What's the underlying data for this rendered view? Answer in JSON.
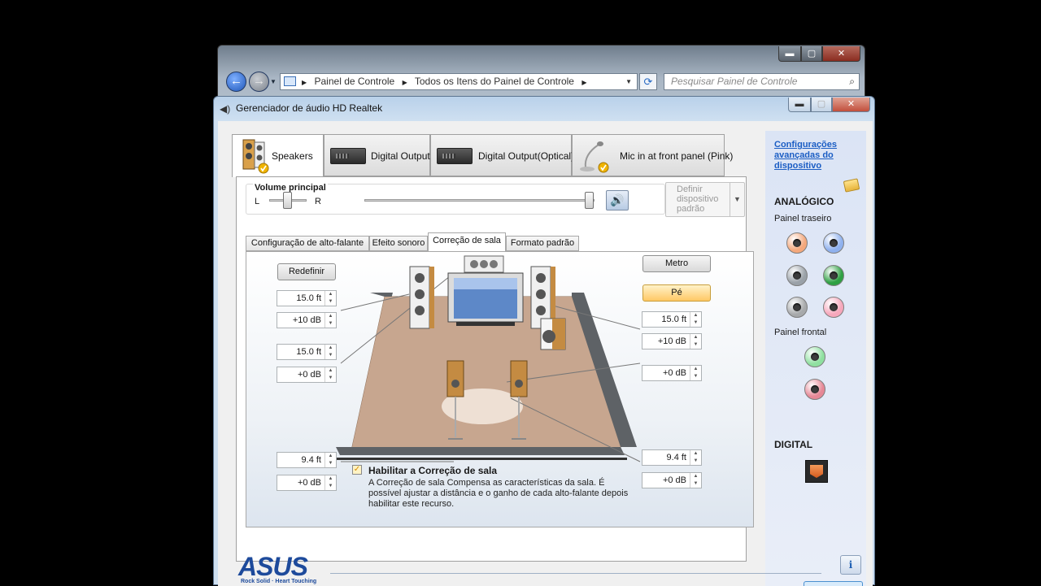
{
  "explorer": {
    "breadcrumb": [
      "Painel de Controle",
      "Todos os Itens do Painel de Controle"
    ],
    "search_placeholder": "Pesquisar Painel de Controle",
    "buttons": {
      "minimize": "▬",
      "maximize": "▢",
      "close": "✕"
    }
  },
  "window": {
    "title": "Gerenciador de áudio HD Realtek",
    "buttons": {
      "minimize": "▬",
      "maximize": "▢",
      "close": "✕"
    }
  },
  "device_tabs": [
    {
      "label": "Speakers",
      "active": true
    },
    {
      "label": "Digital Output",
      "active": false
    },
    {
      "label": "Digital Output(Optical)",
      "active": false
    },
    {
      "label": "Mic in at front panel (Pink)",
      "active": false
    }
  ],
  "volume": {
    "title": "Volume principal",
    "left_label": "L",
    "right_label": "R",
    "balance": 0.5,
    "level": 1.0
  },
  "default_device": {
    "label": "Definir dispositivo padrão"
  },
  "sub_tabs": [
    {
      "label": "Configuração de alto-falante",
      "active": false
    },
    {
      "label": "Efeito sonoro",
      "active": false
    },
    {
      "label": "Correção de sala",
      "active": true
    },
    {
      "label": "Formato padrão",
      "active": false
    }
  ],
  "room": {
    "reset_label": "Redefinir",
    "unit_meter": "Metro",
    "unit_foot": "Pé",
    "selected_unit": "Pé",
    "left_front": {
      "distance": "15.0 ft",
      "gain": "+10 dB"
    },
    "left_side": {
      "distance": "15.0 ft",
      "gain": "+0 dB"
    },
    "left_rear": {
      "distance": "9.4 ft",
      "gain": "+0 dB"
    },
    "right_front": {
      "distance": "15.0 ft",
      "gain": "+10 dB"
    },
    "right_side": {
      "gain": "+0 dB"
    },
    "right_rear": {
      "distance": "9.4 ft",
      "gain": "+0 dB"
    },
    "enable": {
      "checked": true,
      "title": "Habilitar a Correção de sala",
      "description": "A Correção de sala Compensa as características da sala. É possível ajustar a distância e o ganho de cada alto-falante depois habilitar este recurso."
    }
  },
  "sidebar": {
    "advanced_link": "Configurações avançadas do dispositivo",
    "analog_heading": "ANALÓGICO",
    "rear_panel": "Painel traseiro",
    "front_panel": "Painel frontal",
    "digital_heading": "DIGITAL",
    "rear_jacks": [
      "#f4a87c",
      "#8fb1ee",
      "#9aa1a8",
      "#2fa043",
      "#a7a9ab",
      "#f6a7bb"
    ],
    "front_jacks": [
      "#8fe0a0",
      "#e68896"
    ]
  },
  "footer": {
    "brand": "ASUS",
    "tagline": "Rock Solid · Heart Touching",
    "info_icon": "i"
  }
}
